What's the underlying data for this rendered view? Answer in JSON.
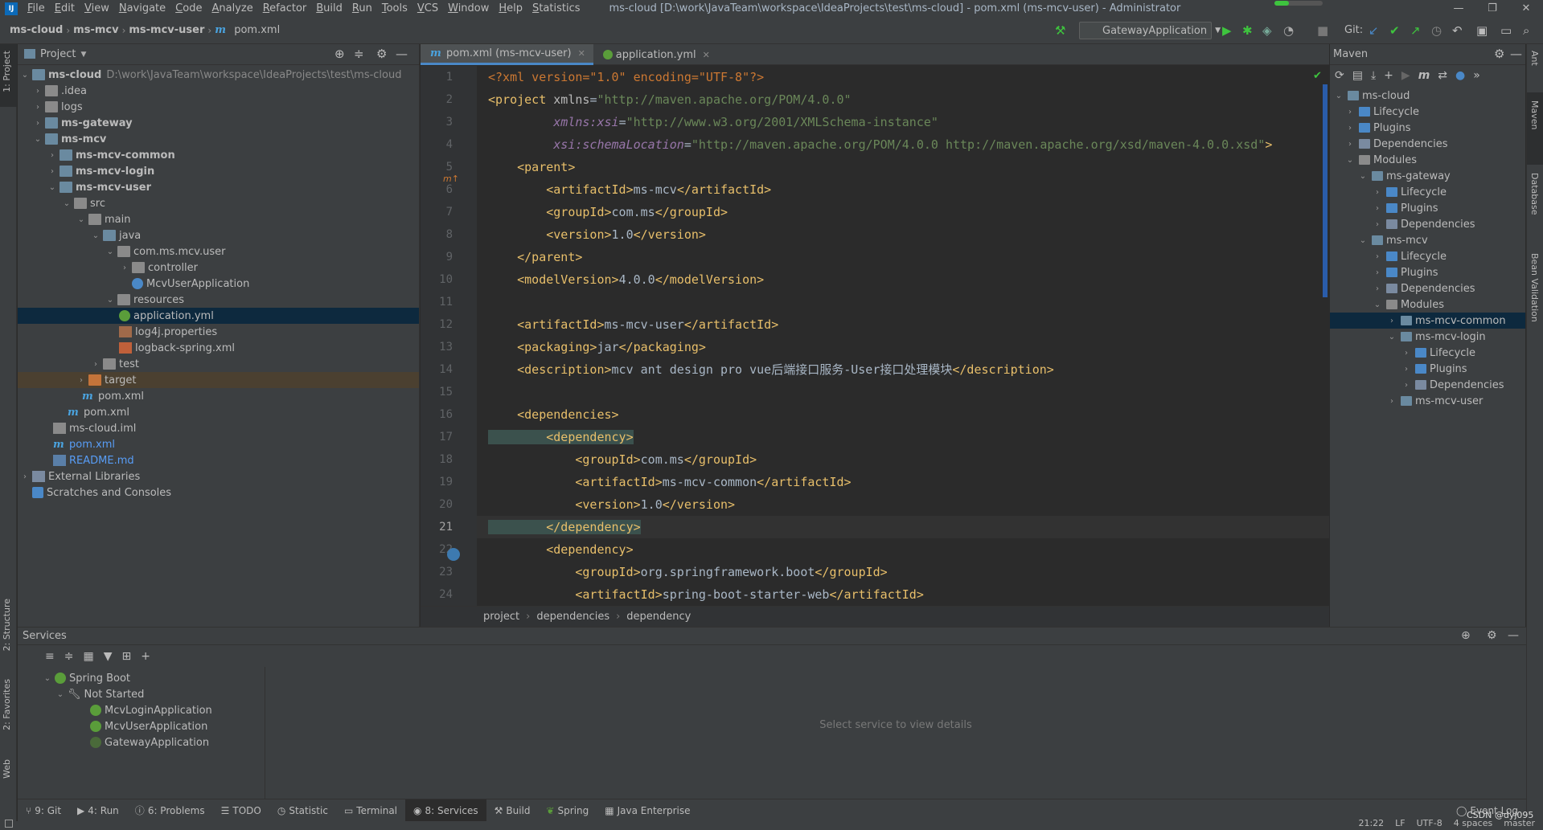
{
  "menu": [
    "File",
    "Edit",
    "View",
    "Navigate",
    "Code",
    "Analyze",
    "Refactor",
    "Build",
    "Run",
    "Tools",
    "VCS",
    "Window",
    "Help",
    "Statistics"
  ],
  "window_title": "ms-cloud [D:\\work\\JavaTeam\\workspace\\IdeaProjects\\test\\ms-cloud] - pom.xml (ms-mcv-user) - Administrator",
  "win_controls": [
    "—",
    "❐",
    "✕"
  ],
  "breadcrumbs": [
    "ms-cloud",
    "ms-mcv",
    "ms-mcv-user",
    "pom.xml"
  ],
  "run_config": "GatewayApplication",
  "git_label": "Git:",
  "left_tabs": {
    "project": "1: Project",
    "structure": "2: Structure",
    "favorites": "2: Favorites",
    "web": "Web"
  },
  "right_tabs": {
    "ant": "Ant",
    "maven": "Maven",
    "database": "Database",
    "bean": "Bean Validation"
  },
  "project": {
    "title": "Project",
    "tree": [
      {
        "label": "ms-cloud",
        "suffix": "D:\\work\\JavaTeam\\workspace\\IdeaProjects\\test\\ms-cloud"
      },
      {
        "label": ".idea"
      },
      {
        "label": "logs"
      },
      {
        "label": "ms-gateway"
      },
      {
        "label": "ms-mcv"
      },
      {
        "label": "ms-mcv-common"
      },
      {
        "label": "ms-mcv-login"
      },
      {
        "label": "ms-mcv-user"
      },
      {
        "label": "src"
      },
      {
        "label": "main"
      },
      {
        "label": "java"
      },
      {
        "label": "com.ms.mcv.user"
      },
      {
        "label": "controller"
      },
      {
        "label": "McvUserApplication"
      },
      {
        "label": "resources"
      },
      {
        "label": "application.yml"
      },
      {
        "label": "log4j.properties"
      },
      {
        "label": "logback-spring.xml"
      },
      {
        "label": "test"
      },
      {
        "label": "target"
      },
      {
        "label": "pom.xml"
      },
      {
        "label": "pom.xml"
      },
      {
        "label": "ms-cloud.iml"
      },
      {
        "label": "pom.xml"
      },
      {
        "label": "README.md"
      },
      {
        "label": "External Libraries"
      },
      {
        "label": "Scratches and Consoles"
      }
    ]
  },
  "editor": {
    "tabs": [
      {
        "label": "pom.xml (ms-mcv-user)"
      },
      {
        "label": "application.yml"
      }
    ],
    "line_numbers": [
      "1",
      "2",
      "3",
      "4",
      "5",
      "6",
      "7",
      "8",
      "9",
      "10",
      "11",
      "12",
      "13",
      "14",
      "15",
      "16",
      "17",
      "18",
      "19",
      "20",
      "21",
      "22",
      "23",
      "24"
    ],
    "code": {
      "l1": "<?xml version=\"1.0\" encoding=\"UTF-8\"?>",
      "l2a": "<project ",
      "l2b": "xmlns",
      "l2c": "=",
      "l2d": "\"http://maven.apache.org/POM/4.0.0\"",
      "l3a": "         xmlns:xsi",
      "l3b": "=",
      "l3c": "\"http://www.w3.org/2001/XMLSchema-instance\"",
      "l4a": "         xsi:schemaLocation",
      "l4b": "=",
      "l4c": "\"http://maven.apache.org/POM/4.0.0 http://maven.apache.org/xsd/maven-4.0.0.xsd\"",
      "l4d": ">",
      "l5": "    <parent>",
      "l6a": "        <artifactId>",
      "l6b": "ms-mcv",
      "l6c": "</artifactId>",
      "l7a": "        <groupId>",
      "l7b": "com.ms",
      "l7c": "</groupId>",
      "l8a": "        <version>",
      "l8b": "1.0",
      "l8c": "</version>",
      "l9": "    </parent>",
      "l10a": "    <modelVersion>",
      "l10b": "4.0.0",
      "l10c": "</modelVersion>",
      "l12a": "    <artifactId>",
      "l12b": "ms-mcv-user",
      "l12c": "</artifactId>",
      "l13a": "    <packaging>",
      "l13b": "jar",
      "l13c": "</packaging>",
      "l14a": "    <description>",
      "l14b": "mcv ant design pro vue后端接口服务-User接口处理模块",
      "l14c": "</description>",
      "l16": "    <dependencies>",
      "l17": "        <dependency>",
      "l18a": "            <groupId>",
      "l18b": "com.ms",
      "l18c": "</groupId>",
      "l19a": "            <artifactId>",
      "l19b": "ms-mcv-common",
      "l19c": "</artifactId>",
      "l20a": "            <version>",
      "l20b": "1.0",
      "l20c": "</version>",
      "l21": "        </dependency>",
      "l22": "        <dependency>",
      "l23a": "            <groupId>",
      "l23b": "org.springframework.boot",
      "l23c": "</groupId>",
      "l24a": "            <artifactId>",
      "l24b": "spring-boot-starter-web",
      "l24c": "</artifactId>"
    },
    "crumbs": [
      "project",
      "dependencies",
      "dependency"
    ]
  },
  "maven": {
    "title": "Maven",
    "tree": [
      "ms-cloud",
      "Lifecycle",
      "Plugins",
      "Dependencies",
      "Modules",
      "ms-gateway",
      "Lifecycle",
      "Plugins",
      "Dependencies",
      "ms-mcv",
      "Lifecycle",
      "Plugins",
      "Dependencies",
      "Modules",
      "ms-mcv-common",
      "ms-mcv-login",
      "Lifecycle",
      "Plugins",
      "Dependencies",
      "ms-mcv-user"
    ]
  },
  "services": {
    "title": "Services",
    "tree": [
      "Spring Boot",
      "Not Started",
      "McvLoginApplication",
      "McvUserApplication",
      "GatewayApplication"
    ],
    "placeholder": "Select service to view details"
  },
  "bottom_tabs": [
    "9: Git",
    "4: Run",
    "6: Problems",
    "TODO",
    "Statistic",
    "Terminal",
    "8: Services",
    "Build",
    "Spring",
    "Java Enterprise"
  ],
  "event_log": "Event Log",
  "status": {
    "pos": "21:22",
    "eol": "LF",
    "enc": "UTF-8",
    "indent": "4 spaces",
    "branch": "master",
    "watermark": "CSDN @dyj095"
  }
}
